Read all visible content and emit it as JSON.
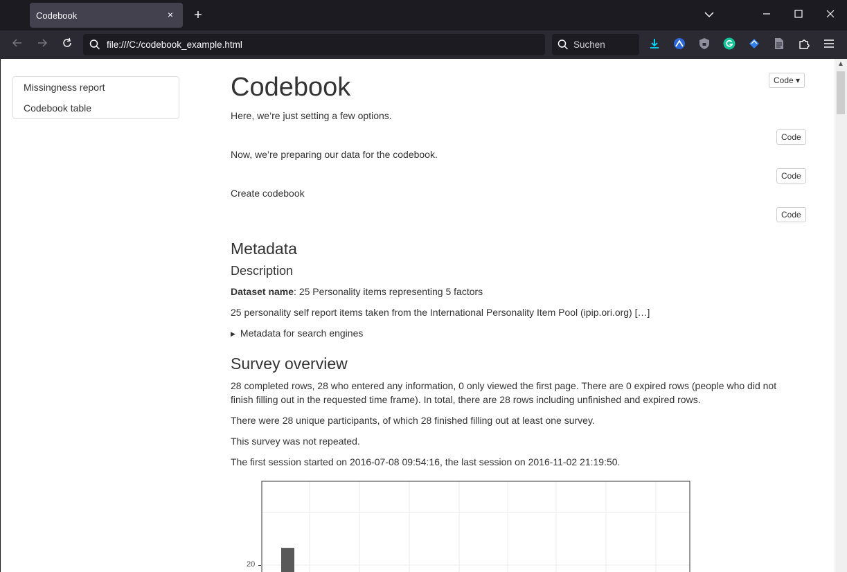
{
  "browser": {
    "tab_title": "Codebook",
    "tab_close": "×",
    "new_tab": "+",
    "url": "file:///C:/codebook_example.html",
    "search_placeholder": "Suchen"
  },
  "toc": {
    "items": [
      {
        "label": "Missingness report"
      },
      {
        "label": "Codebook table"
      }
    ]
  },
  "content": {
    "title": "Codebook",
    "code_dropdown_label": "Code ▾",
    "code_label": "Code",
    "intro1": "Here, we’re just setting a few options.",
    "intro2": "Now, we’re preparing our data for the codebook.",
    "intro3": "Create codebook",
    "metadata_heading": "Metadata",
    "description_heading": "Description",
    "dataset_name_label": "Dataset name",
    "dataset_name_value": ": 25 Personality items representing 5 factors",
    "dataset_description": "25 personality self report items taken from the International Personality Item Pool (ipip.ori.org) […]",
    "metadata_search_engines": "Metadata for search engines",
    "survey_heading": "Survey overview",
    "survey_p1": "28 completed rows, 28 who entered any information, 0 only viewed the first page. There are 0 expired rows (people who did not finish filling out in the requested time frame). In total, there are 28 rows including unfinished and expired rows.",
    "survey_p2": "There were 28 unique participants, of which 28 finished filling out at least one survey.",
    "survey_p3": "This survey was not repeated.",
    "survey_p4": "The first session started on 2016-07-08 09:54:16, the last session on 2016-11-02 21:19:50."
  },
  "chart_data": {
    "type": "bar",
    "visible_y_tick": "20",
    "bars": [
      {
        "value": 26
      }
    ],
    "grid": true,
    "colors": {
      "bar": "#595959",
      "grid": "#ebebeb",
      "panel_border": "#333333"
    }
  }
}
